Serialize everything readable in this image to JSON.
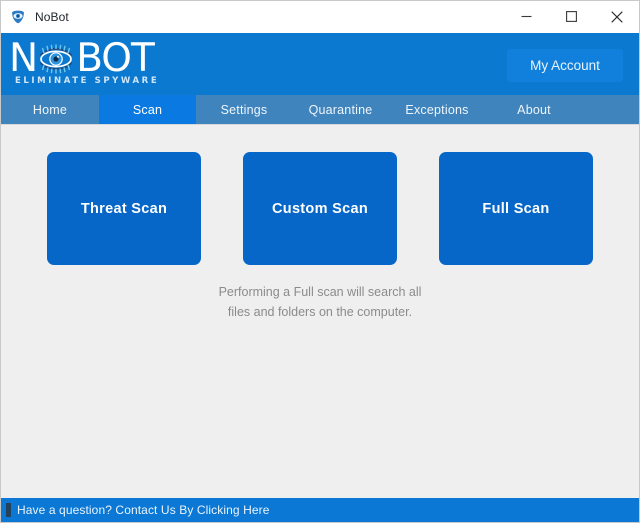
{
  "window": {
    "title": "NoBot",
    "app_icon": "shield-eye-icon",
    "minimize_label": "Minimize",
    "maximize_label": "Maximize",
    "close_label": "Close"
  },
  "brand": {
    "logo_prefix": "N",
    "logo_eye_icon": "eye-logo-icon",
    "logo_suffix": "BOT",
    "tagline": "ELIMINATE SPYWARE",
    "header_color": "#0b79d0"
  },
  "header": {
    "account_button_label": "My Account",
    "account_button_color": "#1180dd"
  },
  "nav": {
    "bar_color": "#4084bd",
    "active_color": "#0a7ae2",
    "active_tab": "Scan",
    "tabs": [
      {
        "label": "Home",
        "active": false
      },
      {
        "label": "Scan",
        "active": true
      },
      {
        "label": "Settings",
        "active": false
      },
      {
        "label": "Quarantine",
        "active": false
      },
      {
        "label": "Exceptions",
        "active": false
      },
      {
        "label": "About",
        "active": false
      }
    ]
  },
  "main": {
    "background_color": "#efefef",
    "tile_color": "#0767c8",
    "scan_tiles": [
      {
        "label": "Threat Scan"
      },
      {
        "label": "Custom Scan"
      },
      {
        "label": "Full Scan"
      }
    ],
    "description": "Performing a Full scan will search all files and folders on the computer."
  },
  "statusbar": {
    "background_color": "#0a78d4",
    "link_text": "Have a question? Contact Us By Clicking Here"
  }
}
